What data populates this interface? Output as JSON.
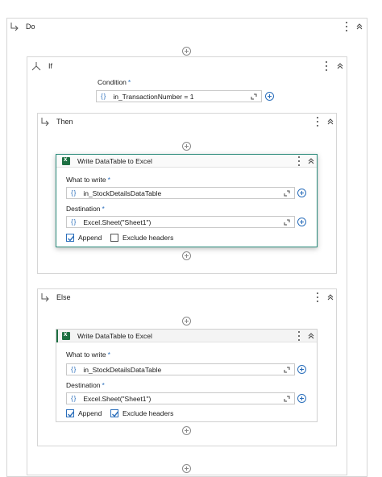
{
  "do": {
    "label": "Do"
  },
  "if_block": {
    "label": "If",
    "condition_label": "Condition",
    "condition_value": "in_TransactionNumber = 1"
  },
  "then_block": {
    "label": "Then",
    "activity": {
      "title": "Write DataTable to Excel",
      "what_label": "What to write",
      "what_value": "in_StockDetailsDataTable",
      "dest_label": "Destination",
      "dest_value": "Excel.Sheet(\"Sheet1\")",
      "append_label": "Append",
      "append_checked": true,
      "exclude_label": "Exclude headers",
      "exclude_checked": false
    }
  },
  "else_block": {
    "label": "Else",
    "activity": {
      "title": "Write DataTable to Excel",
      "what_label": "What to write",
      "what_value": "in_StockDetailsDataTable",
      "dest_label": "Destination",
      "dest_value": "Excel.Sheet(\"Sheet1\")",
      "append_label": "Append",
      "append_checked": true,
      "exclude_label": "Exclude headers",
      "exclude_checked": true
    }
  },
  "required_marker": "*",
  "brace_glyph": "{}",
  "colors": {
    "accent": "#2a6ebb",
    "selection": "#2a8a7a",
    "excel": "#1d6f42"
  }
}
